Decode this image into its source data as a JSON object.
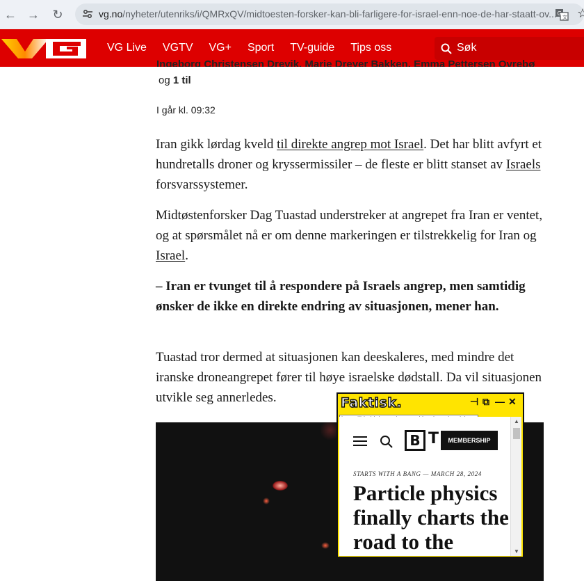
{
  "browser": {
    "url_host": "vg.no",
    "url_path": "/nyheter/utenriks/i/QMRxQV/midtoesten-forsker-kan-bli-farligere-for-israel-enn-noe-de-har-staatt-ov..."
  },
  "header": {
    "nav": [
      "VG Live",
      "VGTV",
      "VG+",
      "Sport",
      "TV-guide",
      "Tips oss"
    ],
    "search_label": "Søk",
    "brand_color": "#dd0000"
  },
  "article": {
    "byline_line1": "Ingeborg Christensen Drevik, Marie Dreyer Bakken, Emma Pettersen Ovrebø",
    "byline_og": "og",
    "byline_more": "1 til",
    "date": "I går kl. 09:32",
    "p1": {
      "t1": "Iran gikk lørdag kveld ",
      "link1": "til direkte angrep mot Israel",
      "t2": ". Det har blitt avfyrt et hundretalls droner og kryssermissiler – de fleste er blitt stanset av ",
      "link2": "Israels",
      "t3": " forsvarssystemer."
    },
    "p2": {
      "t1": "Midtøstenforsker Dag Tuastad understreker at angrepet fra Iran er ventet, og at spørsmålet nå er om denne markeringen er tilstrekkelig for Iran og ",
      "link1": "Israel",
      "t2": "."
    },
    "p3": "– Iran er tvunget til å respondere på Israels angrep, men samtidig ønsker de ikke en direkte endring av situasjonen, mener han.",
    "p4": "Tuastad tror dermed at situasjonen kan deeskaleres, med mindre det iranske droneangrepet fører til høye israelske dødstall. Da vil situasjonen utvikle seg annerledes."
  },
  "faktisk": {
    "logo": "Faktisk.",
    "url": "https://bigthink.com/starts-with-a-bang/particle-",
    "bt_logo_b": "B",
    "bt_logo_t": "T",
    "membership": "MEMBERSHIP",
    "kicker": "STARTS WITH A BANG — MARCH 28, 2024",
    "headline": "Particle physics finally charts the road to the"
  }
}
